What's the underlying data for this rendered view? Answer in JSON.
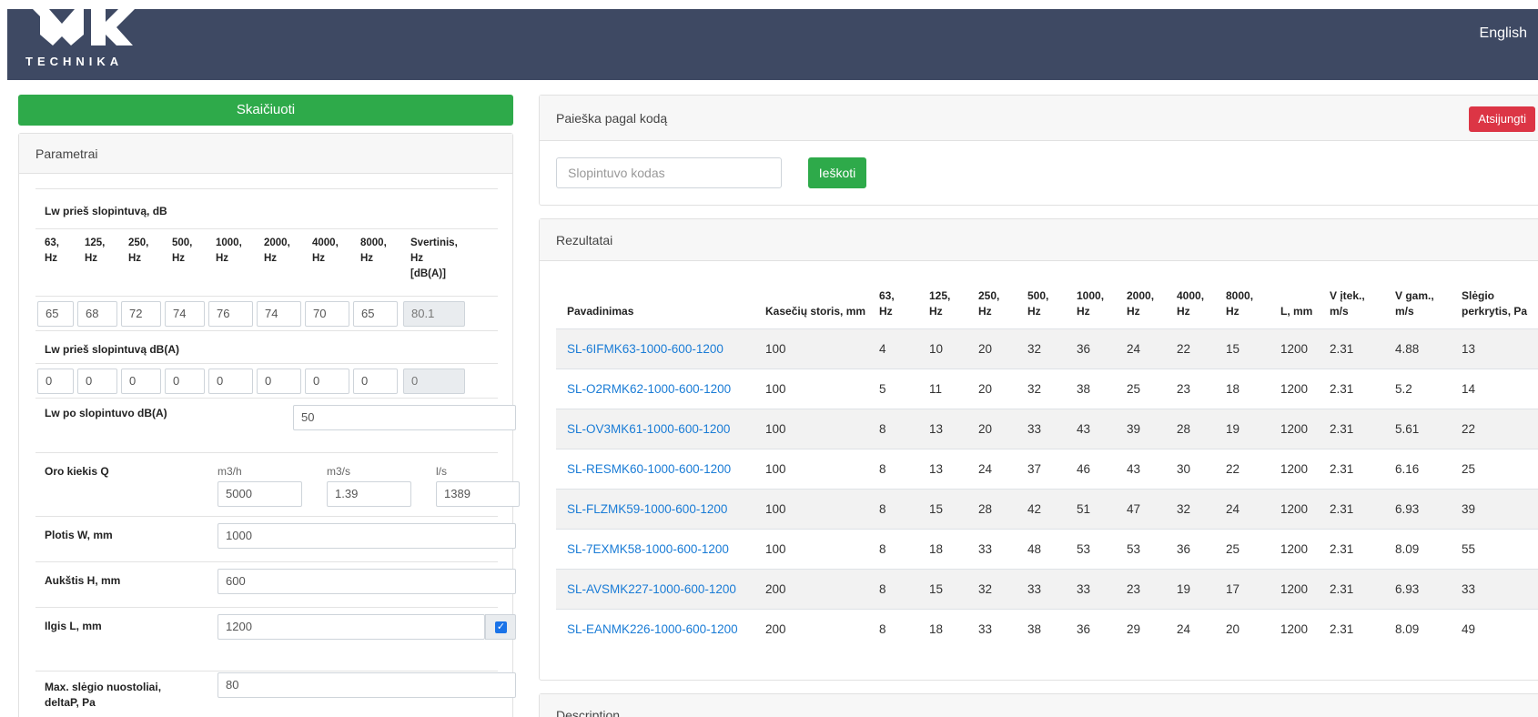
{
  "header": {
    "logo_text": "TECHNIKA",
    "language": "English"
  },
  "left": {
    "calc_button": "Skaičiuoti",
    "params_title": "Parametrai",
    "lw_before_db": {
      "label": "Lw prieš slopintuvą, dB",
      "headers": [
        [
          "63,",
          "Hz"
        ],
        [
          "125,",
          "Hz"
        ],
        [
          "250,",
          "Hz"
        ],
        [
          "500,",
          "Hz"
        ],
        [
          "1000,",
          "Hz"
        ],
        [
          "2000,",
          "Hz"
        ],
        [
          "4000,",
          "Hz"
        ],
        [
          "8000,",
          "Hz"
        ],
        [
          "Svertinis,",
          "Hz",
          "[dB(A)]"
        ]
      ],
      "values": [
        "65",
        "68",
        "72",
        "74",
        "76",
        "74",
        "70",
        "65",
        "80.1"
      ]
    },
    "lw_before_dba": {
      "label": "Lw prieš slopintuvą dB(A)",
      "values": [
        "0",
        "0",
        "0",
        "0",
        "0",
        "0",
        "0",
        "0",
        "0"
      ]
    },
    "lw_after": {
      "label": "Lw po slopintuvo dB(A)",
      "value": "50"
    },
    "airflow": {
      "label": "Oro kiekis Q",
      "units": [
        "m3/h",
        "m3/s",
        "l/s"
      ],
      "values": [
        "5000",
        "1.39",
        "1389"
      ]
    },
    "width": {
      "label": "Plotis W, mm",
      "value": "1000"
    },
    "height": {
      "label": "Aukštis H, mm",
      "value": "600"
    },
    "length": {
      "label": "Ilgis L, mm",
      "value": "1200",
      "checked": "✓"
    },
    "max_pressure": {
      "label_lines": [
        "Max. slėgio nuostoliai,",
        "deltaP, Pa"
      ],
      "value": "80"
    }
  },
  "search": {
    "title": "Paieška pagal kodą",
    "logout": "Atsijungti",
    "placeholder": "Slopintuvo kodas",
    "button": "Ieškoti"
  },
  "results": {
    "title": "Rezultatai",
    "headers": [
      [
        "Pavadinimas"
      ],
      [
        "Kasečių storis, mm"
      ],
      [
        "63,",
        "Hz"
      ],
      [
        "125,",
        "Hz"
      ],
      [
        "250,",
        "Hz"
      ],
      [
        "500,",
        "Hz"
      ],
      [
        "1000,",
        "Hz"
      ],
      [
        "2000,",
        "Hz"
      ],
      [
        "4000,",
        "Hz"
      ],
      [
        "8000,",
        "Hz"
      ],
      [
        "L, mm"
      ],
      [
        "V įtek.,",
        "m/s"
      ],
      [
        "V gam.,",
        "m/s"
      ],
      [
        "Slėgio",
        "perkrytis, Pa"
      ]
    ],
    "rows": [
      [
        "SL-6IFMK63-1000-600-1200",
        "100",
        "4",
        "10",
        "20",
        "32",
        "36",
        "24",
        "22",
        "15",
        "1200",
        "2.31",
        "4.88",
        "13"
      ],
      [
        "SL-O2RMK62-1000-600-1200",
        "100",
        "5",
        "11",
        "20",
        "32",
        "38",
        "25",
        "23",
        "18",
        "1200",
        "2.31",
        "5.2",
        "14"
      ],
      [
        "SL-OV3MK61-1000-600-1200",
        "100",
        "8",
        "13",
        "20",
        "33",
        "43",
        "39",
        "28",
        "19",
        "1200",
        "2.31",
        "5.61",
        "22"
      ],
      [
        "SL-RESMK60-1000-600-1200",
        "100",
        "8",
        "13",
        "24",
        "37",
        "46",
        "43",
        "30",
        "22",
        "1200",
        "2.31",
        "6.16",
        "25"
      ],
      [
        "SL-FLZMK59-1000-600-1200",
        "100",
        "8",
        "15",
        "28",
        "42",
        "51",
        "47",
        "32",
        "24",
        "1200",
        "2.31",
        "6.93",
        "39"
      ],
      [
        "SL-7EXMK58-1000-600-1200",
        "100",
        "8",
        "18",
        "33",
        "48",
        "53",
        "53",
        "36",
        "25",
        "1200",
        "2.31",
        "8.09",
        "55"
      ],
      [
        "SL-AVSMK227-1000-600-1200",
        "200",
        "8",
        "15",
        "32",
        "33",
        "33",
        "23",
        "19",
        "17",
        "1200",
        "2.31",
        "6.93",
        "33"
      ],
      [
        "SL-EANMK226-1000-600-1200",
        "200",
        "8",
        "18",
        "33",
        "38",
        "36",
        "29",
        "24",
        "20",
        "1200",
        "2.31",
        "8.09",
        "49"
      ]
    ]
  },
  "description": {
    "title": "Description"
  }
}
